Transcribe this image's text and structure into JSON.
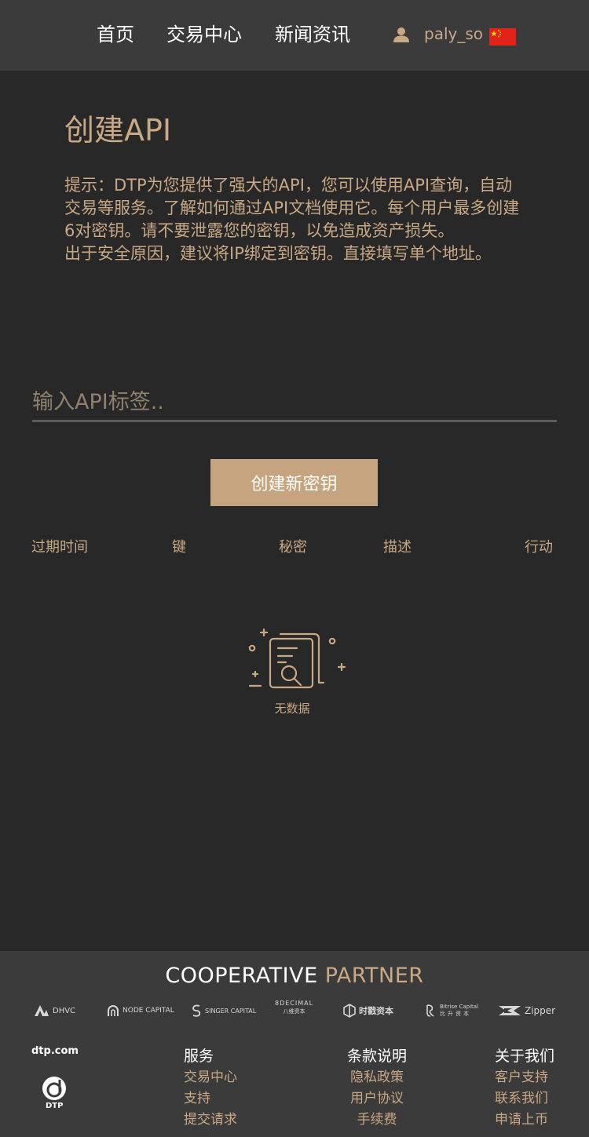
{
  "nav": {
    "items": [
      {
        "label": "首页"
      },
      {
        "label": "交易中心"
      },
      {
        "label": "新闻资讯"
      }
    ],
    "username": "paly_so",
    "user_icon": "user-icon",
    "flag_icon": "china-flag-icon"
  },
  "page": {
    "title": "创建API",
    "hint_line1": "提示：DTP为您提供了强大的API，您可以使用API查询，自动交易等服务。了解如何通过API文档使用它。每个用户最多创建6对密钥。请不要泄露您的密钥，以免造成资产损失。",
    "hint_line2": "出于安全原因，建议将IP绑定到密钥。直接填写单个地址。"
  },
  "form": {
    "input_placeholder": "输入API标签..",
    "input_value": "",
    "create_button": "创建新密钥"
  },
  "table": {
    "headers": [
      "过期时间",
      "键",
      "秘密",
      "描述",
      "行动"
    ],
    "rows": [],
    "empty_text": "无数据",
    "empty_icon": "no-data-icon"
  },
  "footer": {
    "coop_title_a": "COOPERATIVE",
    "coop_title_b": "PARTNER",
    "partners": [
      "DHVC",
      "NODE CAPITAL",
      "SINGER CAPITAL",
      "8DECIMAL",
      "时戳资本",
      "Bitrise Capital",
      "Zipper"
    ],
    "partner_sublabels": {
      "8DECIMAL": "八维资本",
      "Bitrise Capital": "比升资本"
    },
    "domain": "dtp.com",
    "logo_text": "DTP",
    "columns": [
      {
        "heading": "服务",
        "links": [
          "交易中心",
          "支持",
          "提交请求"
        ]
      },
      {
        "heading": "条款说明",
        "links": [
          "隐私政策",
          "用户协议",
          "手续费"
        ]
      },
      {
        "heading": "关于我们",
        "links": [
          "客户支持",
          "联系我们",
          "申请上币"
        ]
      }
    ]
  },
  "colors": {
    "accent": "#c9a886",
    "button": "#c6a47f",
    "background": "#282828",
    "bar": "#3b3b3b"
  }
}
